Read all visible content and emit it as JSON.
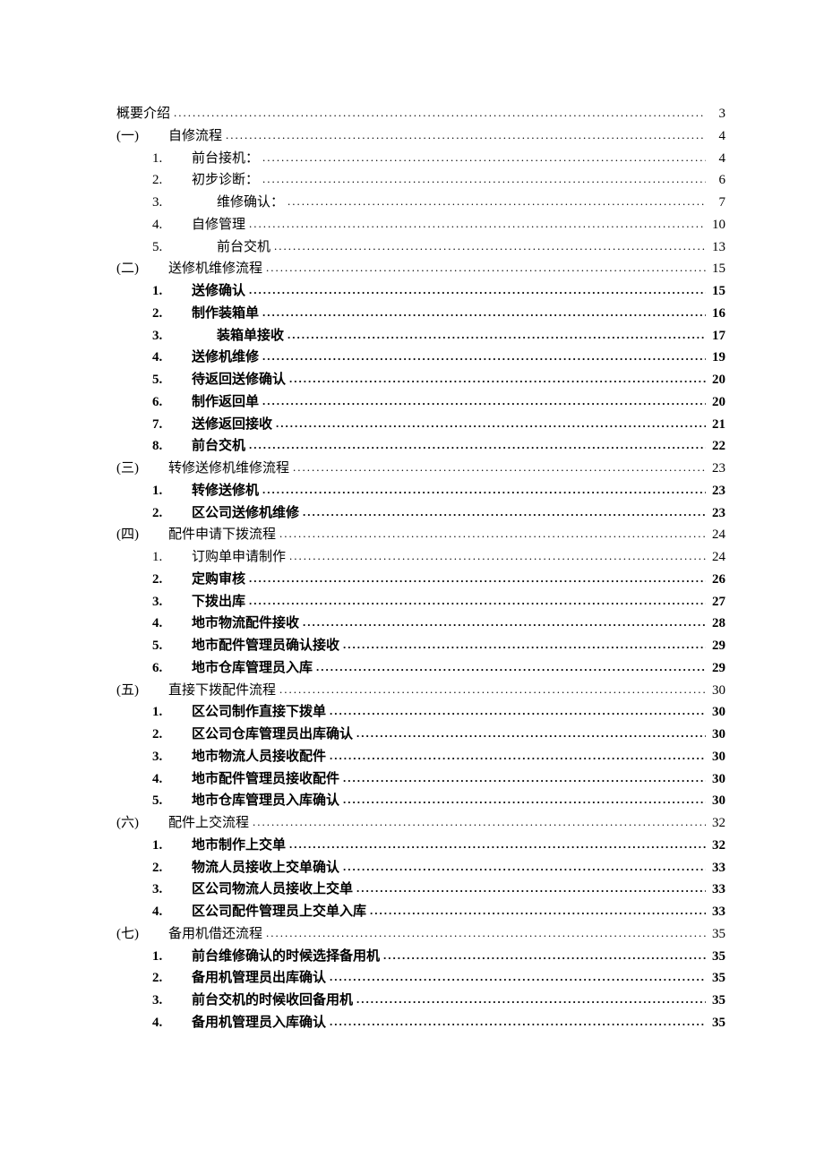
{
  "toc": [
    {
      "level": 0,
      "num": "",
      "title": "概要介绍",
      "page": "3",
      "bold": false,
      "extraIndent": 0
    },
    {
      "level": 1,
      "num": "(一)",
      "title": "自修流程",
      "page": "4",
      "bold": false,
      "extraIndent": 0
    },
    {
      "level": 2,
      "num": "1.",
      "title": "前台接机：",
      "page": "4",
      "bold": false,
      "extraIndent": 0
    },
    {
      "level": 2,
      "num": "2.",
      "title": "初步诊断：",
      "page": "6",
      "bold": false,
      "extraIndent": 0
    },
    {
      "level": 2,
      "num": "3.",
      "title": "维修确认：",
      "page": "7",
      "bold": false,
      "extraIndent": 28
    },
    {
      "level": 2,
      "num": "4.",
      "title": "自修管理",
      "page": "10",
      "bold": false,
      "extraIndent": 0
    },
    {
      "level": 2,
      "num": "5.",
      "title": "前台交机",
      "page": "13",
      "bold": false,
      "extraIndent": 28
    },
    {
      "level": 1,
      "num": "(二)",
      "title": "送修机维修流程",
      "page": "15",
      "bold": false,
      "extraIndent": 0
    },
    {
      "level": 2,
      "num": "1.",
      "title": "送修确认",
      "page": "15",
      "bold": true,
      "extraIndent": 0
    },
    {
      "level": 2,
      "num": "2.",
      "title": "制作装箱单",
      "page": "16",
      "bold": true,
      "extraIndent": 0
    },
    {
      "level": 2,
      "num": "3.",
      "title": "装箱单接收",
      "page": "17",
      "bold": true,
      "extraIndent": 28
    },
    {
      "level": 2,
      "num": "4.",
      "title": "送修机维修",
      "page": "19",
      "bold": true,
      "extraIndent": 0
    },
    {
      "level": 2,
      "num": "5.",
      "title": "待返回送修确认",
      "page": "20",
      "bold": true,
      "extraIndent": 0
    },
    {
      "level": 2,
      "num": "6.",
      "title": "制作返回单",
      "page": "20",
      "bold": true,
      "extraIndent": 0
    },
    {
      "level": 2,
      "num": "7.",
      "title": "送修返回接收",
      "page": "21",
      "bold": true,
      "extraIndent": 0
    },
    {
      "level": 2,
      "num": "8.",
      "title": "前台交机",
      "page": "22",
      "bold": true,
      "extraIndent": 0
    },
    {
      "level": 1,
      "num": "(三)",
      "title": "转修送修机维修流程",
      "page": "23",
      "bold": false,
      "extraIndent": 0
    },
    {
      "level": 2,
      "num": "1.",
      "title": "转修送修机",
      "page": "23",
      "bold": true,
      "extraIndent": 0
    },
    {
      "level": 2,
      "num": "2.",
      "title": "区公司送修机维修",
      "page": "23",
      "bold": true,
      "extraIndent": 0
    },
    {
      "level": 1,
      "num": "(四)",
      "title": "配件申请下拨流程",
      "page": "24",
      "bold": false,
      "extraIndent": 0
    },
    {
      "level": 2,
      "num": "1.",
      "title": "订购单申请制作",
      "page": "24",
      "bold": false,
      "extraIndent": 0
    },
    {
      "level": 2,
      "num": "2.",
      "title": "定购审核",
      "page": "26",
      "bold": true,
      "extraIndent": 0
    },
    {
      "level": 2,
      "num": "3.",
      "title": "下拨出库",
      "page": "27",
      "bold": true,
      "extraIndent": 0
    },
    {
      "level": 2,
      "num": "4.",
      "title": "地市物流配件接收",
      "page": "28",
      "bold": true,
      "extraIndent": 0
    },
    {
      "level": 2,
      "num": "5.",
      "title": "地市配件管理员确认接收",
      "page": "29",
      "bold": true,
      "extraIndent": 0
    },
    {
      "level": 2,
      "num": "6.",
      "title": "地市仓库管理员入库",
      "page": "29",
      "bold": true,
      "extraIndent": 0
    },
    {
      "level": 1,
      "num": "(五)",
      "title": "直接下拨配件流程",
      "page": "30",
      "bold": false,
      "extraIndent": 0
    },
    {
      "level": 2,
      "num": "1.",
      "title": "区公司制作直接下拨单",
      "page": "30",
      "bold": true,
      "extraIndent": 0
    },
    {
      "level": 2,
      "num": "2.",
      "title": "区公司仓库管理员出库确认",
      "page": "30",
      "bold": true,
      "extraIndent": 0
    },
    {
      "level": 2,
      "num": "3.",
      "title": "地市物流人员接收配件",
      "page": "30",
      "bold": true,
      "extraIndent": 0
    },
    {
      "level": 2,
      "num": "4.",
      "title": "地市配件管理员接收配件",
      "page": "30",
      "bold": true,
      "extraIndent": 0
    },
    {
      "level": 2,
      "num": "5.",
      "title": "地市仓库管理员入库确认",
      "page": "30",
      "bold": true,
      "extraIndent": 0
    },
    {
      "level": 1,
      "num": "(六)",
      "title": "配件上交流程",
      "page": "32",
      "bold": false,
      "extraIndent": 0
    },
    {
      "level": 2,
      "num": "1.",
      "title": "地市制作上交单",
      "page": "32",
      "bold": true,
      "extraIndent": 0
    },
    {
      "level": 2,
      "num": "2.",
      "title": "物流人员接收上交单确认",
      "page": "33",
      "bold": true,
      "extraIndent": 0
    },
    {
      "level": 2,
      "num": "3.",
      "title": "区公司物流人员接收上交单",
      "page": "33",
      "bold": true,
      "extraIndent": 0
    },
    {
      "level": 2,
      "num": "4.",
      "title": "区公司配件管理员上交单入库",
      "page": "33",
      "bold": true,
      "extraIndent": 0
    },
    {
      "level": 1,
      "num": "(七)",
      "title": "备用机借还流程",
      "page": "35",
      "bold": false,
      "extraIndent": 0
    },
    {
      "level": 2,
      "num": "1.",
      "title": "前台维修确认的时候选择备用机",
      "page": "35",
      "bold": true,
      "extraIndent": 0
    },
    {
      "level": 2,
      "num": "2.",
      "title": "备用机管理员出库确认",
      "page": "35",
      "bold": true,
      "extraIndent": 0
    },
    {
      "level": 2,
      "num": "3.",
      "title": "前台交机的时候收回备用机",
      "page": "35",
      "bold": true,
      "extraIndent": 0
    },
    {
      "level": 2,
      "num": "4.",
      "title": "备用机管理员入库确认",
      "page": "35",
      "bold": true,
      "extraIndent": 0
    }
  ]
}
